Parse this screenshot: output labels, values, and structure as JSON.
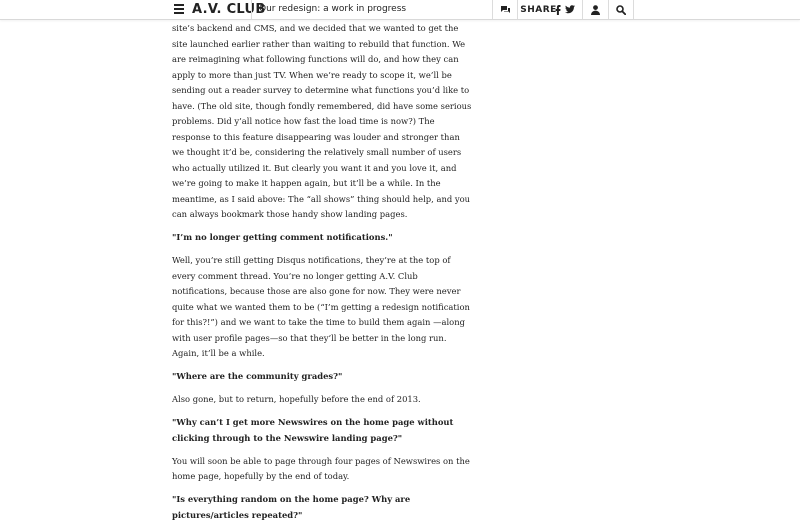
{
  "header": {
    "logo": "A.V. CLUB",
    "article_title": "Our redesign: a work in progress",
    "share_label": "SHARE",
    "icons": [
      "menu-icon",
      "comments-icon",
      "facebook-icon",
      "twitter-icon",
      "user-icon",
      "search-icon"
    ]
  },
  "article": {
    "paragraphs": [
      {
        "type": "body",
        "text": "site’s backend and CMS, and we decided that we wanted to get the site launched earlier rather than waiting to rebuild that function. We are reimagining what following functions will do, and how they can apply to more than just TV. When we’re ready to scope it, we’ll be sending out a reader survey to determine what functions you’d like to have. (The old site, though fondly remembered, did have some serious problems. Did y’all notice how fast the load time is now?) The response to this feature disappearing was louder and stronger than we thought it’d be, considering the relatively small number of users who actually utilized it. But clearly you want it and you love it, and we’re going to make it happen again, but it’ll be a while. In the meantime, as I said above: The “all shows” thing should help, and you can always bookmark those handy show landing pages."
      },
      {
        "type": "question",
        "text": "\"I’m no longer getting comment notifications.\""
      },
      {
        "type": "body",
        "text": "Well, you’re still getting Disqus notifications, they’re at the top of every comment thread. You’re no longer getting A.V. Club notifications, because those are also gone for now. They were never quite what we wanted them to be (“I’m getting a redesign notification for this?!”) and we want to take the time to build them again —along with user profile pages—so that they’ll be better in the long run. Again, it’ll be a while."
      },
      {
        "type": "question",
        "text": "\"Where are the community grades?\""
      },
      {
        "type": "body",
        "text": "Also gone, but to return, hopefully before the end of 2013."
      },
      {
        "type": "question",
        "text": "\"Why can’t I get more Newswires on the home page without clicking through to the Newswire landing page?\""
      },
      {
        "type": "body",
        "text": "You will soon be able to page through four pages of Newswires on the home page, hopefully by the end of today."
      },
      {
        "type": "question",
        "text": "\"Is everything random on the home page? Why are pictures/articles repeated?\""
      }
    ]
  }
}
